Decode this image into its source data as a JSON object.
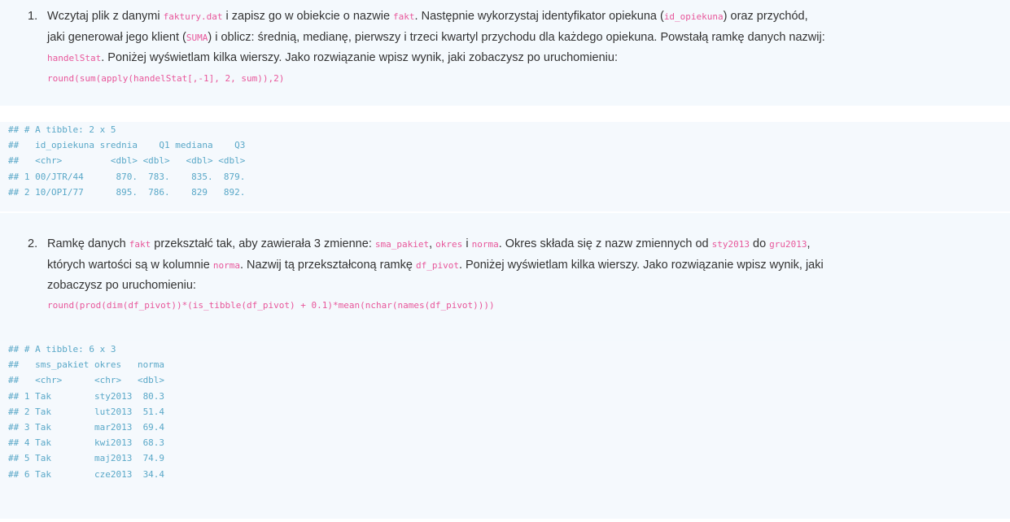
{
  "task1": {
    "number": "1.",
    "line1": [
      {
        "t": "Wczytaj plik z danymi ",
        "code": false
      },
      {
        "t": "faktury.dat",
        "code": true
      },
      {
        "t": " i zapisz go w obiekcie o nazwie ",
        "code": false
      },
      {
        "t": "fakt",
        "code": true
      },
      {
        "t": ". Następnie wykorzystaj identyfikator opiekuna (",
        "code": false
      },
      {
        "t": "id_opiekuna",
        "code": true
      },
      {
        "t": ") oraz przychód,",
        "code": false
      }
    ],
    "line2": [
      {
        "t": "jaki generował jego klient (",
        "code": false
      },
      {
        "t": "SUMA",
        "code": true
      },
      {
        "t": ") i oblicz: średnią, medianę, pierwszy i trzeci kwartyl przychodu dla każdego opiekuna. Powstałą ramkę danych nazwij:",
        "code": false
      }
    ],
    "line3": [
      {
        "t": "handelStat",
        "code": true
      },
      {
        "t": ". Poniżej wyświetlam kilka wierszy. Jako rozwiązanie wpisz wynik, jaki zobaczysz po uruchomieniu:",
        "code": false
      }
    ],
    "code": "round(sum(apply(handelStat[,-1], 2, sum)),2)"
  },
  "output1": [
    "## # A tibble: 2 x 5",
    "##   id_opiekuna srednia    Q1 mediana    Q3",
    "##   <chr>         <dbl> <dbl>   <dbl> <dbl>",
    "## 1 00/JTR/44      870.  783.    835.  879.",
    "## 2 10/OPI/77      895.  786.    829   892."
  ],
  "task2": {
    "number": "2.",
    "line1": [
      {
        "t": "Ramkę danych ",
        "code": false
      },
      {
        "t": "fakt",
        "code": true
      },
      {
        "t": " przekształć tak, aby zawierała 3 zmienne: ",
        "code": false
      },
      {
        "t": "sma_pakiet",
        "code": true
      },
      {
        "t": ", ",
        "code": false
      },
      {
        "t": "okres",
        "code": true
      },
      {
        "t": " i ",
        "code": false
      },
      {
        "t": "norma",
        "code": true
      },
      {
        "t": ". Okres składa się z nazw zmiennych od ",
        "code": false
      },
      {
        "t": "sty2013",
        "code": true
      },
      {
        "t": " do ",
        "code": false
      },
      {
        "t": "gru2013",
        "code": true
      },
      {
        "t": ",",
        "code": false
      }
    ],
    "line2": [
      {
        "t": "których wartości są w kolumnie ",
        "code": false
      },
      {
        "t": "norma",
        "code": true
      },
      {
        "t": ". Nazwij tą przekształconą ramkę ",
        "code": false
      },
      {
        "t": "df_pivot",
        "code": true
      },
      {
        "t": ". Poniżej wyświetlam kilka wierszy. Jako rozwiązanie wpisz wynik, jaki",
        "code": false
      }
    ],
    "line3": [
      {
        "t": "zobaczysz po uruchomieniu:",
        "code": false
      }
    ],
    "code": "round(prod(dim(df_pivot))*(is_tibble(df_pivot) + 0.1)*mean(nchar(names(df_pivot))))"
  },
  "output2": [
    "## # A tibble: 6 x 3",
    "##   sms_pakiet okres   norma",
    "##   <chr>      <chr>   <dbl>",
    "## 1 Tak        sty2013  80.3",
    "## 2 Tak        lut2013  51.4",
    "## 3 Tak        mar2013  69.4",
    "## 4 Tak        kwi2013  68.3",
    "## 5 Tak        maj2013  74.9",
    "## 6 Tak        cze2013  34.4"
  ]
}
